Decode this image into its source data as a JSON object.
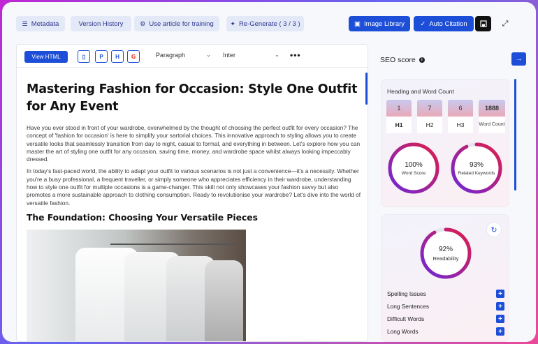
{
  "toolbar": {
    "metadata": "Metadata",
    "version_history": "Version History",
    "use_article": "Use article for training",
    "regenerate": "Re-Generate ( 3 / 3 )",
    "image_library": "Image Library",
    "auto_citation": "Auto Citation"
  },
  "editor": {
    "view_html": "View HTML",
    "block_type": "Paragraph",
    "font": "Inter",
    "icons": [
      "docx-icon",
      "pdf-icon",
      "html-file-icon",
      "google-docs-icon"
    ]
  },
  "article": {
    "title": "Mastering Fashion for Occasion: Style One Outfit for Any Event",
    "paragraphs": [
      "Have you ever stood in front of your wardrobe, overwhelmed by the thought of choosing the perfect outfit for every occasion? The concept of 'fashion for occasion' is here to simplify your sartorial choices. This innovative approach to styling allows you to create versatile looks that seamlessly transition from day to night, casual to formal, and everything in between. Let's explore how you can master the art of styling one outfit for any occasion, saving time, money, and wardrobe space whilst always looking impeccably dressed.",
      "In today's fast-paced world, the ability to adapt your outfit to various scenarios is not just a convenience—it's a necessity. Whether you're a busy professional, a frequent traveller, or simply someone who appreciates efficiency in their wardrobe, understanding how to style one outfit for multiple occasions is a game-changer. This skill not only showcases your fashion savvy but also promotes a more sustainable approach to clothing consumption. Ready to revolutionise your wardrobe? Let's dive into the world of versatile fashion."
    ],
    "subheading": "The Foundation: Choosing Your Versatile Pieces"
  },
  "seo": {
    "title": "SEO score",
    "heading_card": {
      "title": "Heading and Word Count",
      "items": [
        {
          "value": "1",
          "label": "H1"
        },
        {
          "value": "7",
          "label": "H2"
        },
        {
          "value": "6",
          "label": "H3"
        },
        {
          "value": "1888",
          "label": "Word Count"
        }
      ],
      "word_score": {
        "pct": "100%",
        "label": "Word Score",
        "value": 100
      },
      "related_keywords": {
        "pct": "93%",
        "label": "Related Keywords",
        "value": 93
      }
    },
    "readability": {
      "pct": "92%",
      "label": "Readability",
      "value": 92
    },
    "issues": [
      "Spelling Issues",
      "Long Sentences",
      "Difficult Words",
      "Long Words"
    ]
  },
  "colors": {
    "accent": "#1d4ed8",
    "ring_start": "#6d28d9",
    "ring_end": "#e11d48"
  }
}
